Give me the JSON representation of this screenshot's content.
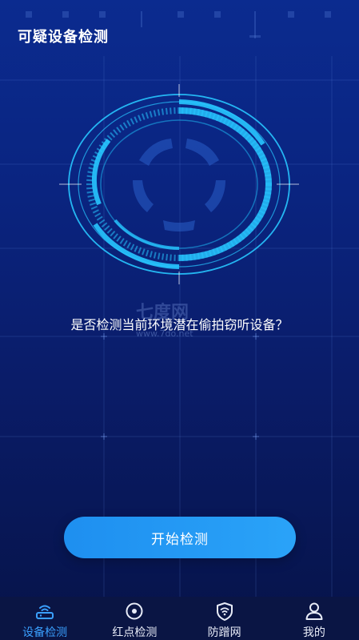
{
  "header": {
    "title": "可疑设备检测"
  },
  "main": {
    "prompt": "是否检测当前环境潜在偷拍窃听设备？",
    "start_button": "开始检测"
  },
  "watermark": {
    "main": "七度网",
    "sub": "www.7do.net"
  },
  "tabbar": {
    "items": [
      {
        "label": "设备检测",
        "icon": "wifi-router-icon",
        "active": true
      },
      {
        "label": "红点检测",
        "icon": "target-dot-icon",
        "active": false
      },
      {
        "label": "防蹭网",
        "icon": "shield-wifi-icon",
        "active": false
      },
      {
        "label": "我的",
        "icon": "user-icon",
        "active": false
      }
    ]
  },
  "colors": {
    "accent": "#2aa3f8",
    "active_tab": "#3aa0ff",
    "radar_cyan": "#27c6ff",
    "background_top": "#0b2b8f",
    "background_bottom": "#061348"
  }
}
